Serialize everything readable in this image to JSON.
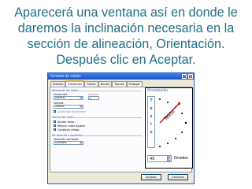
{
  "headline": {
    "line1": "Aparecerá una ventana así en donde le",
    "line2": "daremos la inclinación necesaria en la",
    "line3": "sección de alineación, Orientación.",
    "line4": "Después clic en Aceptar."
  },
  "dialog": {
    "title": "Formato de celdas",
    "tabs": [
      {
        "label": "Número",
        "active": false
      },
      {
        "label": "Alineación",
        "active": true
      },
      {
        "label": "Fuente",
        "active": false
      },
      {
        "label": "Bordes",
        "active": false
      },
      {
        "label": "Tramas",
        "active": false
      },
      {
        "label": "Proteger",
        "active": false
      }
    ],
    "alignment": {
      "section": "Alineación del texto",
      "horizontal_label": "Horizontal:",
      "horizontal_value": "General",
      "indent_label": "Sangría:",
      "indent_value": "0",
      "vertical_label": "Vertical:",
      "vertical_value": "Inferior",
      "distributed": "Justificado distribuido"
    },
    "control": {
      "section": "Control del texto",
      "wrap": "Ajustar texto",
      "shrink": "Reducir hasta ajustar",
      "merge": "Combinar celdas"
    },
    "rtl": {
      "section": "De derecha a izquierda",
      "direction_label": "Dirección del texto:",
      "direction_value": "Contexto"
    },
    "orientation": {
      "title": "Orientación",
      "vertical_text": [
        "T",
        "e",
        "x",
        "t",
        "o"
      ],
      "dial_text": "Texto",
      "degrees_value": "45",
      "degrees_label": "Grados"
    },
    "buttons": {
      "ok": "Aceptar",
      "cancel": "Cancelar"
    }
  }
}
